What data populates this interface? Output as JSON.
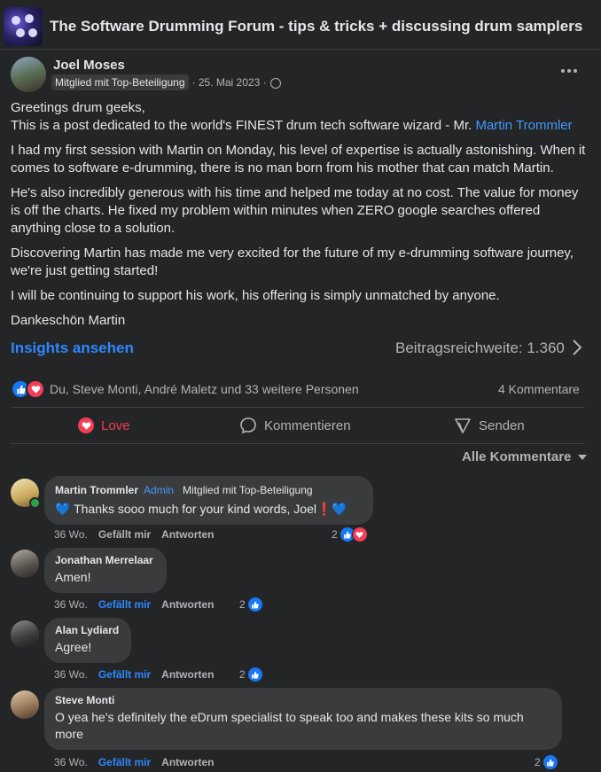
{
  "header": {
    "title": "The Software Drumming Forum - tips & tricks + discussing drum samplers"
  },
  "post": {
    "author": "Joel Moses",
    "badge": "Mitglied mit Top-Beteiligung",
    "date": "· 25. Mai 2023 ·",
    "greeting": "Greetings drum geeks,",
    "intro": "This is a post dedicated to the world's FINEST drum tech software wizard - Mr. ",
    "mention": "Martin Trommler",
    "p2": "I had my first session with Martin on Monday, his level of expertise is actually astonishing. When it comes to software e-drumming, there is no man born from his mother that can match Martin.",
    "p3": "He's also incredibly generous with his time and helped me today at no cost. The value for money is off the charts. He fixed my problem within minutes when ZERO google searches offered anything close to a solution.",
    "p4": "Discovering Martin has made me very excited for the future of my e-drumming software journey, we're just getting started!",
    "p5": "I will be continuing to support his work, his offering is simply unmatched by anyone.",
    "p6": "Dankeschön Martin"
  },
  "insights": {
    "link": "Insights ansehen",
    "reach": "Beitragsreichweite: 1.360"
  },
  "reactions": {
    "summary": "Du, Steve Monti, André Maletz und 33 weitere Personen",
    "comments": "4 Kommentare"
  },
  "actions": {
    "love": "Love",
    "comment": "Kommentieren",
    "send": "Senden"
  },
  "filter": {
    "label": "Alle Kommentare"
  },
  "comments": [
    {
      "name": "Martin Trommler",
      "admin": "Admin",
      "badge": "Mitglied mit Top-Beteiligung",
      "text": "💙 Thanks sooo much for your kind words, Joel❗💙",
      "time": "36 Wo.",
      "like": "Gefällt mir",
      "reply": "Antworten",
      "count": "2"
    },
    {
      "name": "Jonathan Merrelaar",
      "text": "Amen!",
      "time": "36 Wo.",
      "like": "Gefällt mir",
      "reply": "Antworten",
      "count": "2"
    },
    {
      "name": "Alan Lydiard",
      "text": "Agree!",
      "time": "36 Wo.",
      "like": "Gefällt mir",
      "reply": "Antworten",
      "count": "2"
    },
    {
      "name": "Steve Monti",
      "text": "O yea he's definitely the eDrum specialist to speak too and makes these kits so much more",
      "time": "36 Wo.",
      "like": "Gefällt mir",
      "reply": "Antworten",
      "count": "2"
    }
  ],
  "colors": {
    "background": "#242526",
    "bubble": "#3a3b3c",
    "link": "#2d88ff",
    "love": "#f33e58",
    "like": "#1877f2"
  }
}
